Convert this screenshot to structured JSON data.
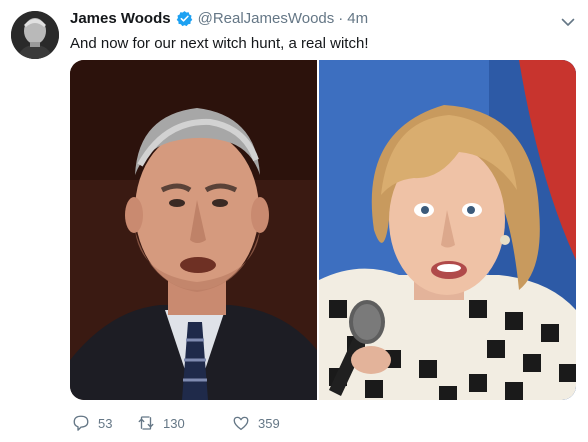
{
  "tweet": {
    "author_name": "James Woods",
    "handle": "@RealJamesWoods",
    "separator": "·",
    "time": "4m",
    "text": "And now for our next witch hunt, a real witch!",
    "verified": true,
    "accent_color": "#1da1f2",
    "media": {
      "count": 2
    },
    "actions": {
      "reply_count": "53",
      "retweet_count": "130",
      "like_count": "359"
    }
  },
  "icons": {
    "verified": "verified-badge-icon",
    "caret": "chevron-down-icon",
    "reply": "reply-bubble-icon",
    "retweet": "retweet-arrows-icon",
    "like": "heart-icon"
  }
}
